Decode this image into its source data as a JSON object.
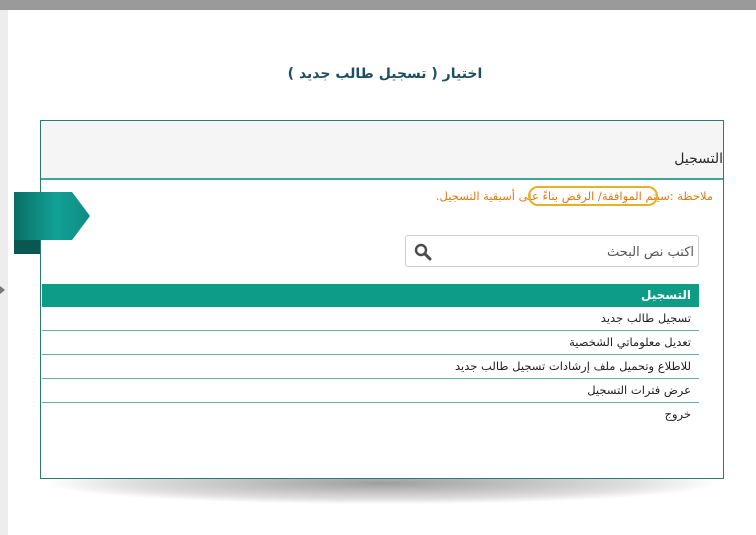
{
  "page": {
    "title": "اختيار ( تسجيل طالب جديد )"
  },
  "card": {
    "header_title": "التسجيل",
    "note": "ملاحظة :سيتم الموافقة/ الرفض بناءً على أسبقية التسجيل."
  },
  "search": {
    "placeholder": "اكتب نص البحث",
    "icon": "search-icon"
  },
  "list": {
    "header": "التسجيل",
    "items": [
      "تسجيل طالب جديد",
      "تعديل معلوماتي الشخصية",
      "للاطلاع وتحميل ملف إرشادات تسجيل طالب جديد",
      "عرض فترات التسجيل",
      "خروج"
    ],
    "highlighted_index": 0
  },
  "colors": {
    "accent": "#0d9c86",
    "title": "#1d4f63",
    "note": "#e07a10",
    "highlight": "#e8b028"
  }
}
